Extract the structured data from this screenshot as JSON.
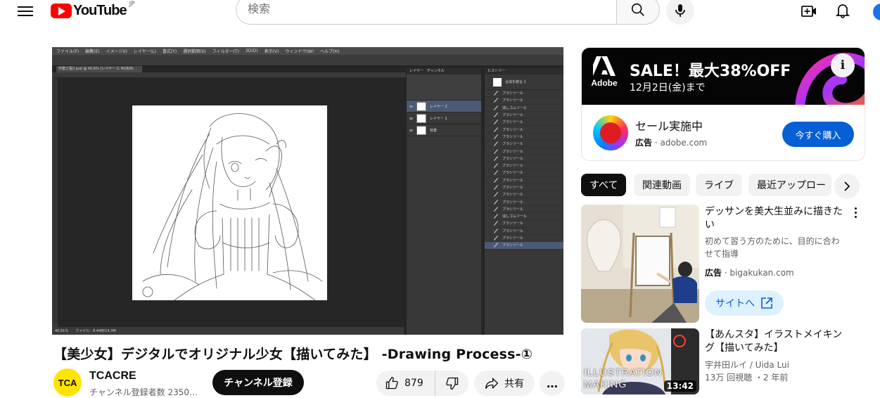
{
  "header": {
    "logo_text": "YouTube",
    "region": "JP",
    "search_placeholder": "検索"
  },
  "player": {
    "ps_menu": [
      "ファイル(F)",
      "編集(E)",
      "イメージ(I)",
      "レイヤー(L)",
      "書式(Y)",
      "選択範囲(S)",
      "フィルター(T)",
      "3D(D)",
      "表示(V)",
      "ウィンドウ(W)",
      "ヘルプ(H)"
    ],
    "ps_doc_tab": "作業工程2.psd @ 40.6% (レイヤー 2, RGB/8)",
    "ps_status_zoom": "40.61%",
    "ps_status_file": "ファイル：8.44M/14.3M",
    "ps_layers_tab": "レイヤー　チャンネル",
    "ps_layers": [
      {
        "name": "レイヤー 2",
        "active": true
      },
      {
        "name": "レイヤー 1",
        "active": false
      },
      {
        "name": "背景",
        "active": false
      }
    ],
    "ps_history_tab": "ヒストリー",
    "ps_history_head": "合成を統合 1",
    "ps_history_items": [
      "ブラシツール",
      "ブラシツール",
      "消しゴムツール",
      "ブラシツール",
      "ブラシツール",
      "ブラシツール",
      "ブラシツール",
      "ブラシツール",
      "ブラシツール",
      "ブラシツール",
      "ブラシツール",
      "ブラシツール",
      "ブラシツール",
      "ブラシツール",
      "ブラシツール",
      "ブラシツール",
      "ブラシツール",
      "消しゴムツール",
      "ブラシツール",
      "ブラシツール",
      "ブラシツール",
      "ブラシツール"
    ]
  },
  "video": {
    "title": "【美少女】デジタルでオリジナル少女【描いてみた】 -Drawing Process-①",
    "channel_avatar_text": "TCA",
    "channel_name": "TCACRE",
    "subscribers": "チャンネル登録者数 2350…",
    "subscribe_label": "チャンネル登録",
    "like_count": "879",
    "share_label": "共有",
    "more_label": "…"
  },
  "ad": {
    "brand_logo_text": "Adobe",
    "sale_text": "SALE！最大38%OFF",
    "sale_date": "12月2日(金)まで",
    "headline": "セール実施中",
    "sponsored_label": "広告",
    "domain": "adobe.com",
    "cta": "今すぐ購入"
  },
  "chips": [
    {
      "label": "すべて",
      "active": true
    },
    {
      "label": "関連動画",
      "active": false
    },
    {
      "label": "ライブ",
      "active": false
    },
    {
      "label": "最近アップロー",
      "active": false
    }
  ],
  "recommendations": [
    {
      "title": "デッサンを美大生並みに描きたい",
      "description": "初めて習う方のために、目的に合わせて指導",
      "sponsored_label": "広告",
      "domain": "bigakukan.com",
      "cta": "サイトへ"
    },
    {
      "title": "【あんスタ】イラストメイキング【描いてみた】",
      "channel": "宇井田ルイ / Uida Lui",
      "views": "13万 回視聴",
      "age": "2 年前",
      "duration": "13:42",
      "thumb_text_1": "ILLUSTRATION",
      "thumb_text_2": "MAKING"
    }
  ],
  "colors": {
    "brand_red": "#ff0000",
    "cta_blue": "#065fd4",
    "ps_active_layer": "#4c5a75"
  }
}
